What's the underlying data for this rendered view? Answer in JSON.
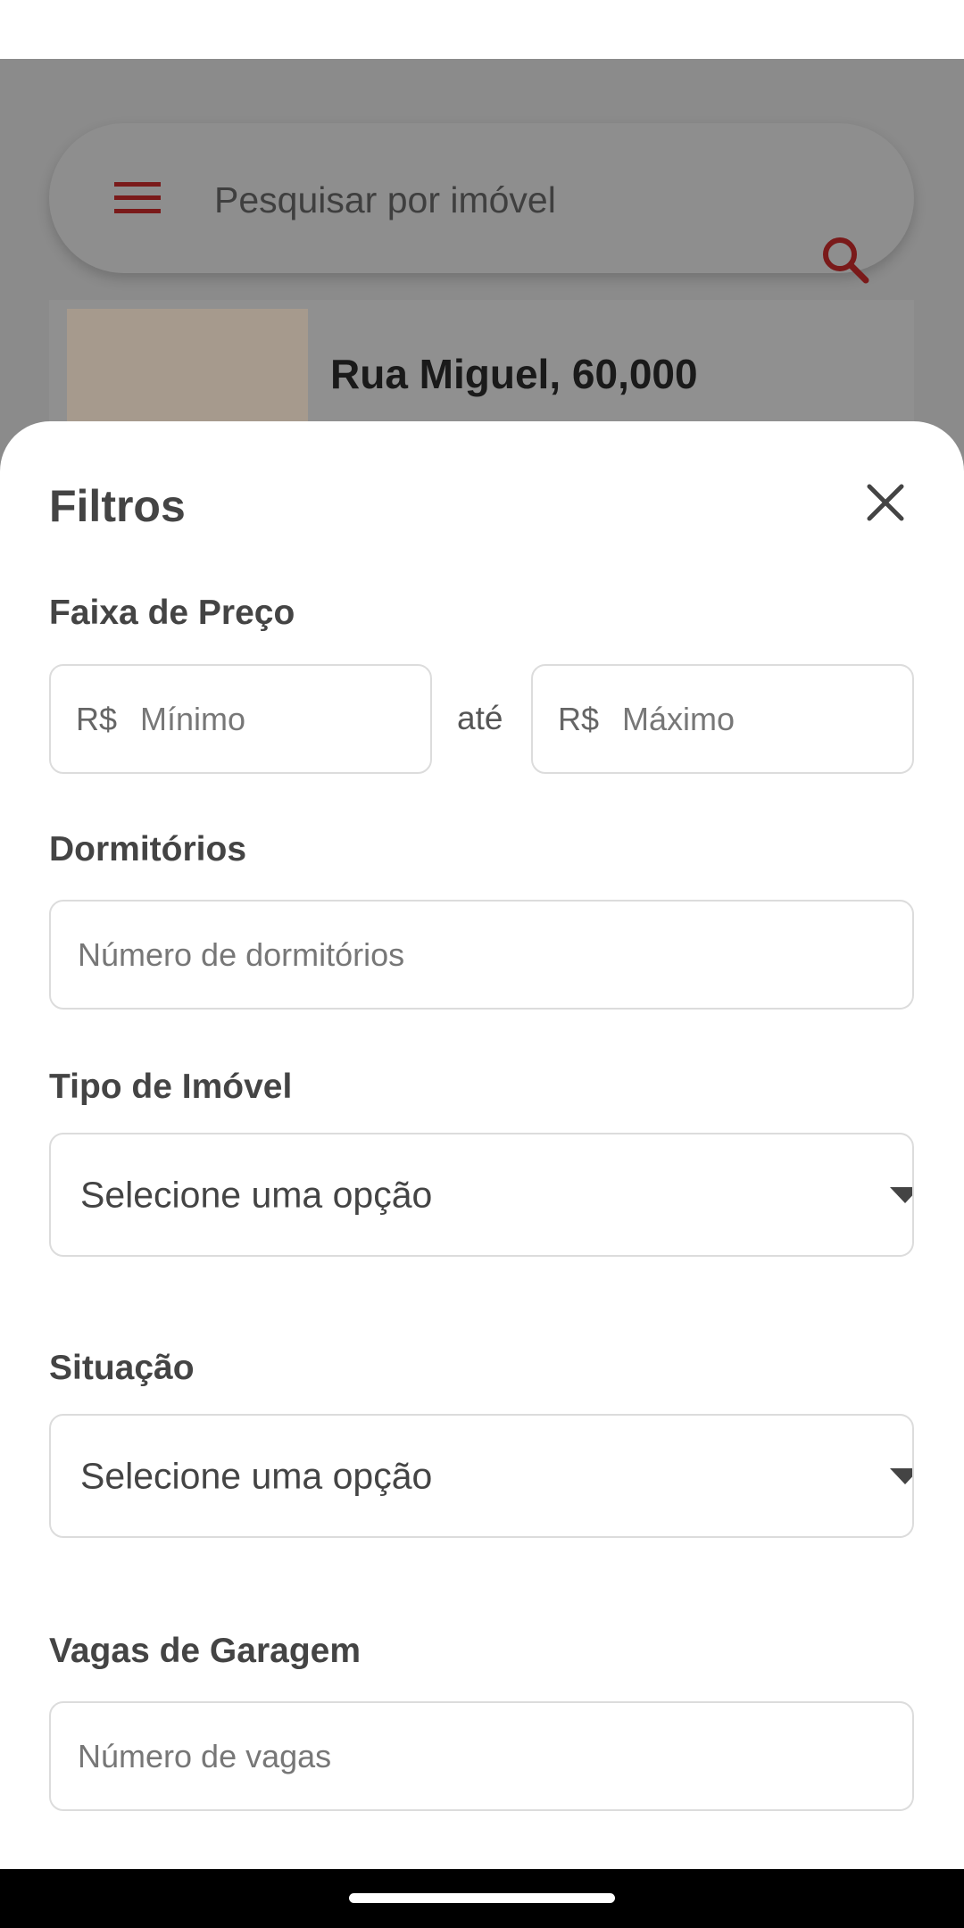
{
  "search": {
    "placeholder": "Pesquisar por imóvel"
  },
  "background_result": {
    "title": "Rua Miguel, 60,000"
  },
  "filters": {
    "title": "Filtros",
    "price": {
      "label": "Faixa de Preço",
      "currency": "R$",
      "min_placeholder": "Mínimo",
      "separator": "até",
      "max_placeholder": "Máximo"
    },
    "bedrooms": {
      "label": "Dormitórios",
      "placeholder": "Número de dormitórios"
    },
    "property_type": {
      "label": "Tipo de Imóvel",
      "selected": "Selecione uma opção"
    },
    "status": {
      "label": "Situação",
      "selected": "Selecione uma opção"
    },
    "parking": {
      "label": "Vagas de Garagem",
      "placeholder": "Número de vagas"
    }
  },
  "colors": {
    "brand": "#8b1a1a",
    "overlay": "#8b8b8b",
    "text": "#444444",
    "border": "#dcdcdc"
  },
  "icons": {
    "menu": "menu-icon",
    "search": "search-icon",
    "close": "close-icon",
    "dropdown": "chevron-down-icon"
  }
}
